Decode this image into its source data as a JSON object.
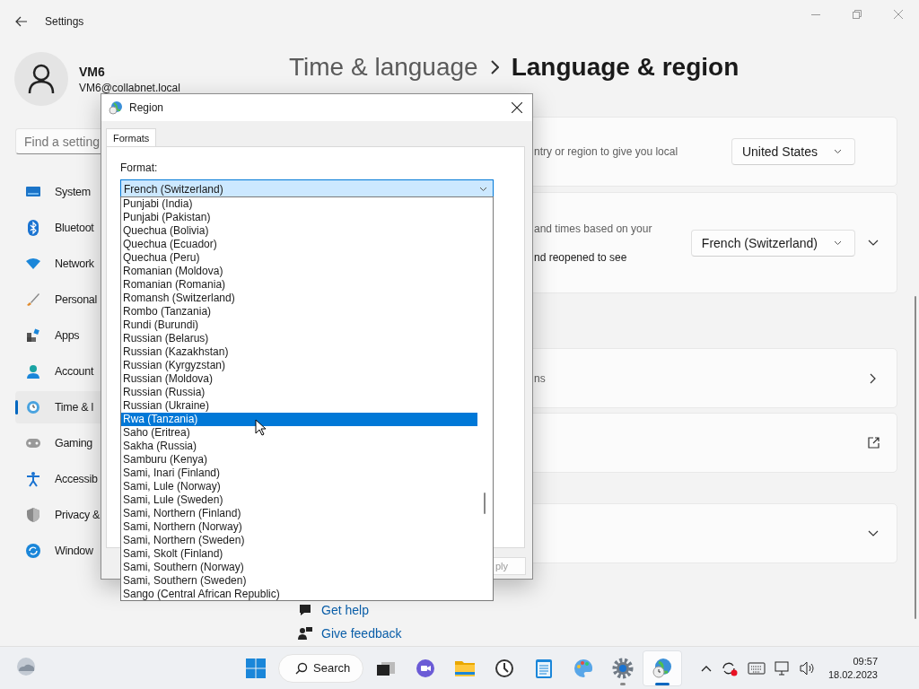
{
  "window": {
    "title": "Settings"
  },
  "user": {
    "name": "VM6",
    "email": "VM6@collabnet.local"
  },
  "search": {
    "placeholder": "Find a setting"
  },
  "nav": [
    {
      "kind": "system",
      "label": "System",
      "selected": false
    },
    {
      "kind": "bluetooth",
      "label": "Bluetoot",
      "selected": false
    },
    {
      "kind": "network",
      "label": "Network",
      "selected": false
    },
    {
      "kind": "personalization",
      "label": "Personal",
      "selected": false
    },
    {
      "kind": "apps",
      "label": "Apps",
      "selected": false
    },
    {
      "kind": "accounts",
      "label": "Account",
      "selected": false
    },
    {
      "kind": "time",
      "label": "Time & l",
      "selected": true
    },
    {
      "kind": "gaming",
      "label": "Gaming",
      "selected": false
    },
    {
      "kind": "accessibility",
      "label": "Accessib",
      "selected": false
    },
    {
      "kind": "privacy",
      "label": "Privacy &",
      "selected": false
    },
    {
      "kind": "update",
      "label": "Window",
      "selected": false
    }
  ],
  "breadcrumb": {
    "parent": "Time & language",
    "current": "Language & region"
  },
  "cards": [
    {
      "kind": "dropdown",
      "lines": [
        {
          "text": "ntry or region to give you local",
          "kind": "secondary"
        }
      ],
      "value": "United States"
    },
    {
      "kind": "dropdown-expand",
      "lines": [
        {
          "text": "and times based on your",
          "kind": "secondary"
        },
        {
          "text": "nd reopened to see",
          "kind": "primary"
        }
      ],
      "value": "French (Switzerland)"
    },
    {
      "kind": "link",
      "lines": [
        {
          "text": "ns",
          "kind": "secondary"
        }
      ]
    },
    {
      "kind": "external"
    },
    {
      "kind": "expand"
    }
  ],
  "links": [
    {
      "kind": "help",
      "label": "Get help"
    },
    {
      "kind": "feedback",
      "label": "Give feedback"
    }
  ],
  "dialog": {
    "title": "Region",
    "tabs": [
      {
        "label": "Formats",
        "selected": true
      }
    ],
    "format_label": "Format:",
    "format_value": "French (Switzerland)",
    "apply": "ply",
    "options": [
      {
        "label": "Punjabi (India)",
        "selected": false
      },
      {
        "label": "Punjabi (Pakistan)",
        "selected": false
      },
      {
        "label": "Quechua (Bolivia)",
        "selected": false
      },
      {
        "label": "Quechua (Ecuador)",
        "selected": false
      },
      {
        "label": "Quechua (Peru)",
        "selected": false
      },
      {
        "label": "Romanian (Moldova)",
        "selected": false
      },
      {
        "label": "Romanian (Romania)",
        "selected": false
      },
      {
        "label": "Romansh (Switzerland)",
        "selected": false
      },
      {
        "label": "Rombo (Tanzania)",
        "selected": false
      },
      {
        "label": "Rundi (Burundi)",
        "selected": false
      },
      {
        "label": "Russian (Belarus)",
        "selected": false
      },
      {
        "label": "Russian (Kazakhstan)",
        "selected": false
      },
      {
        "label": "Russian (Kyrgyzstan)",
        "selected": false
      },
      {
        "label": "Russian (Moldova)",
        "selected": false
      },
      {
        "label": "Russian (Russia)",
        "selected": false
      },
      {
        "label": "Russian (Ukraine)",
        "selected": false
      },
      {
        "label": "Rwa (Tanzania)",
        "selected": true
      },
      {
        "label": "Saho (Eritrea)",
        "selected": false
      },
      {
        "label": "Sakha (Russia)",
        "selected": false
      },
      {
        "label": "Samburu (Kenya)",
        "selected": false
      },
      {
        "label": "Sami, Inari (Finland)",
        "selected": false
      },
      {
        "label": "Sami, Lule (Norway)",
        "selected": false
      },
      {
        "label": "Sami, Lule (Sweden)",
        "selected": false
      },
      {
        "label": "Sami, Northern (Finland)",
        "selected": false
      },
      {
        "label": "Sami, Northern (Norway)",
        "selected": false
      },
      {
        "label": "Sami, Northern (Sweden)",
        "selected": false
      },
      {
        "label": "Sami, Skolt (Finland)",
        "selected": false
      },
      {
        "label": "Sami, Southern (Norway)",
        "selected": false
      },
      {
        "label": "Sami, Southern (Sweden)",
        "selected": false
      },
      {
        "label": "Sango (Central African Republic)",
        "selected": false
      }
    ]
  },
  "taskbar": {
    "search": "Search",
    "apps": [
      {
        "kind": "taskview",
        "running": false,
        "active": false
      },
      {
        "kind": "chat",
        "running": false,
        "active": false
      },
      {
        "kind": "explorer",
        "running": false,
        "active": false
      },
      {
        "kind": "clock",
        "running": false,
        "active": false
      },
      {
        "kind": "notepad",
        "running": false,
        "active": false
      },
      {
        "kind": "paint",
        "running": false,
        "active": false
      },
      {
        "kind": "settings",
        "running": true,
        "active": false
      },
      {
        "kind": "region",
        "running": true,
        "active": true
      }
    ],
    "time": "09:57",
    "date": "18.02.2023"
  }
}
